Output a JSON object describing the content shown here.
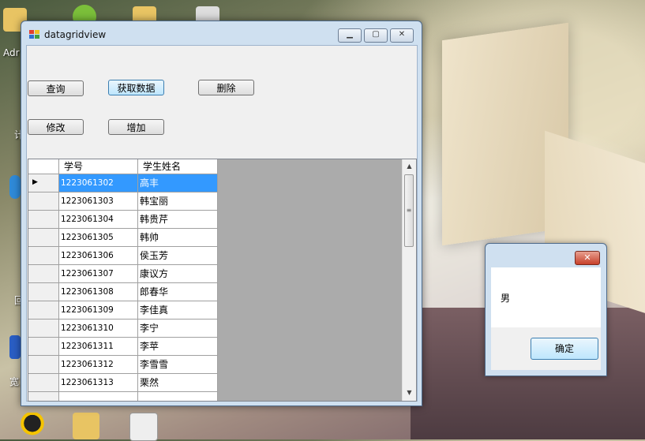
{
  "window": {
    "title": "datagridview",
    "min_glyph": "▁",
    "max_glyph": "▢",
    "close_glyph": "✕"
  },
  "buttons": {
    "query": "查询",
    "fetch": "获取数据",
    "delete": "删除",
    "modify": "修改",
    "add": "增加"
  },
  "grid": {
    "columns": [
      "学号",
      "学生姓名"
    ],
    "rows": [
      {
        "id": "1223061302",
        "name": "高丰"
      },
      {
        "id": "1223061303",
        "name": "韩宝丽"
      },
      {
        "id": "1223061304",
        "name": "韩贵芹"
      },
      {
        "id": "1223061305",
        "name": "韩帅"
      },
      {
        "id": "1223061306",
        "name": "侯玉芳"
      },
      {
        "id": "1223061307",
        "name": "康议方"
      },
      {
        "id": "1223061308",
        "name": "郎春华"
      },
      {
        "id": "1223061309",
        "name": "李佳真"
      },
      {
        "id": "1223061310",
        "name": "李宁"
      },
      {
        "id": "1223061311",
        "name": "李苹"
      },
      {
        "id": "1223061312",
        "name": "李雪雪"
      },
      {
        "id": "1223061313",
        "name": "栗然"
      }
    ],
    "selected_row_marker": "▶",
    "scroll_up": "▲",
    "scroll_down": "▼",
    "scroll_grip": "≡"
  },
  "messagebox": {
    "text": "男",
    "ok_label": "确定",
    "close_glyph": "✕"
  },
  "desktop": {
    "labels": [
      "Adr",
      "计",
      "回",
      "宽"
    ]
  }
}
